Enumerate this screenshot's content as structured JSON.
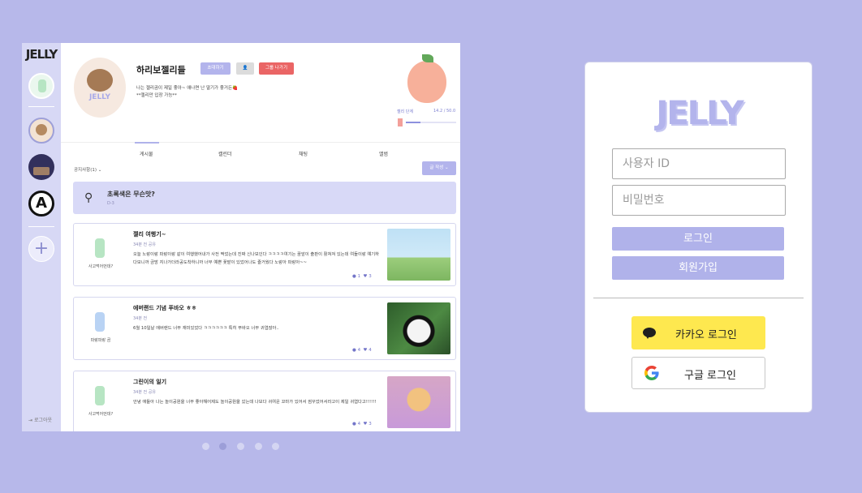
{
  "preview": {
    "sidebar": {
      "logo": "JELLY",
      "logout": "로그아웃"
    },
    "group": {
      "avatar_text": "JELLY",
      "name": "하리보젤리들",
      "invite_label": "초대하기",
      "leave_label": "그룹 나가기",
      "desc_line1": "나는 젤리곰이 제일 좋아~ 애나면 난 딸기가 좋거든🍓",
      "desc_line2": "**젤리만 입장 가능**",
      "level_label": "젤리 단계",
      "level_value": "14.2 / 50.0",
      "level_fraction": 0.284
    },
    "tabs": [
      "게시물",
      "캘린더",
      "채팅",
      "앨범"
    ],
    "notice_filter": "공지사항(1)  ⌄",
    "write_label": "글 작성  ⌄",
    "pinned": {
      "title": "초록색은 무슨맛?",
      "time": "D-3"
    },
    "posts": [
      {
        "author": "사고먹어먼데?",
        "title": "젤리 여행기~",
        "time": "34분 전 공유",
        "body": "오늘 노랑이랑 파랑이랑 같이 여행했어내가 사전 짝었는데 진짜 신나보인다 ㅋㅋㅋㅋ여기는 꿈앞이 출판이 활쳐져 있는데 여들이랑 얘기하다보니까 금방 지나가더라공도착하니까 너무 예쁜 꽃밭이 있었어나도 즐거웠다 노랑아 파랑아~~",
        "comments": "1",
        "likes": "3",
        "gummy_color": "#b7e5c3"
      },
      {
        "author": "파랑파랑 곰",
        "title": "에버랜드 기념 푸바오 ㅎㅎ",
        "time": "34분 전",
        "body": "6월 10일날 에버랜드 너무 재미있었다 ㅋㅋㅋㅋㅋㅋ 특히 푸바오 너무 귀엽잖아..",
        "comments": "4",
        "likes": "4",
        "gummy_color": "#b9d3f4"
      },
      {
        "author": "사고먹어먼데?",
        "title": "그린이의 일기",
        "time": "34분 전 공유",
        "body": "안녕 애들아 나는 놀이공원을 너무 좋아해어제도 놀이공원을 갔는데 나보다 귀여운 꼬마가 있어서 썸꾸었어서라고이 제일 귀엽다고!!!!!!",
        "comments": "4",
        "likes": "3",
        "gummy_color": "#b7e5c3"
      }
    ]
  },
  "carousel": {
    "count": 5,
    "active_index": 1
  },
  "login": {
    "logo": "JELLY",
    "username_placeholder": "사용자 ID",
    "password_placeholder": "비밀번호",
    "login_label": "로그인",
    "signup_label": "회원가입",
    "kakao_label": "카카오 로그인",
    "google_label": "구글 로그인"
  },
  "colors": {
    "background": "#b7b8ea",
    "accent": "#b0b2ea",
    "kakao": "#fee84f"
  }
}
